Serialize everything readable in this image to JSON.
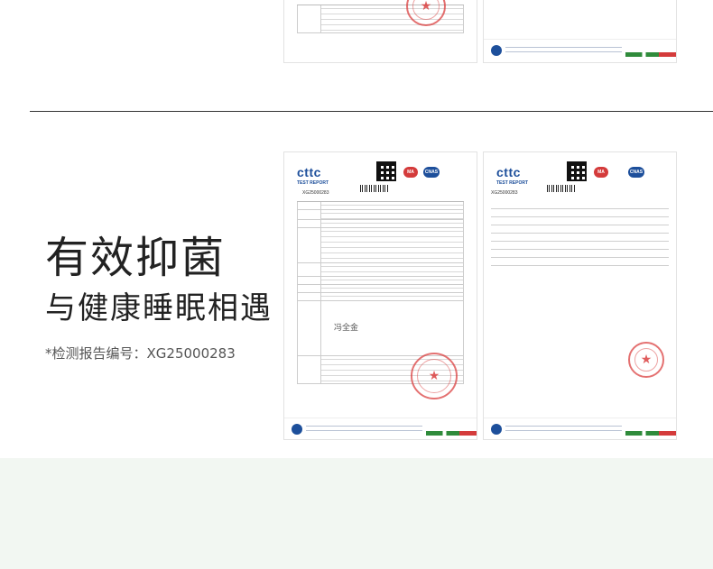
{
  "headline": {
    "line1": "有效抑菌",
    "line2": "与健康睡眠相遇",
    "report_number": "*检测报告编号：XG25000283"
  },
  "report_doc": {
    "logo": "cttc",
    "logo_subtitle": "TEST REPORT",
    "header_badges": [
      "MA",
      "CNAS"
    ],
    "report_no": "XG25000283",
    "signature": "冯全金",
    "colors": {
      "brand_blue": "#1d4f9b",
      "stamp_red": "#d83434",
      "green": "#2f8b3b"
    }
  },
  "colors": {
    "bottom_band": "#f2f7f2",
    "divider": "#333333"
  }
}
